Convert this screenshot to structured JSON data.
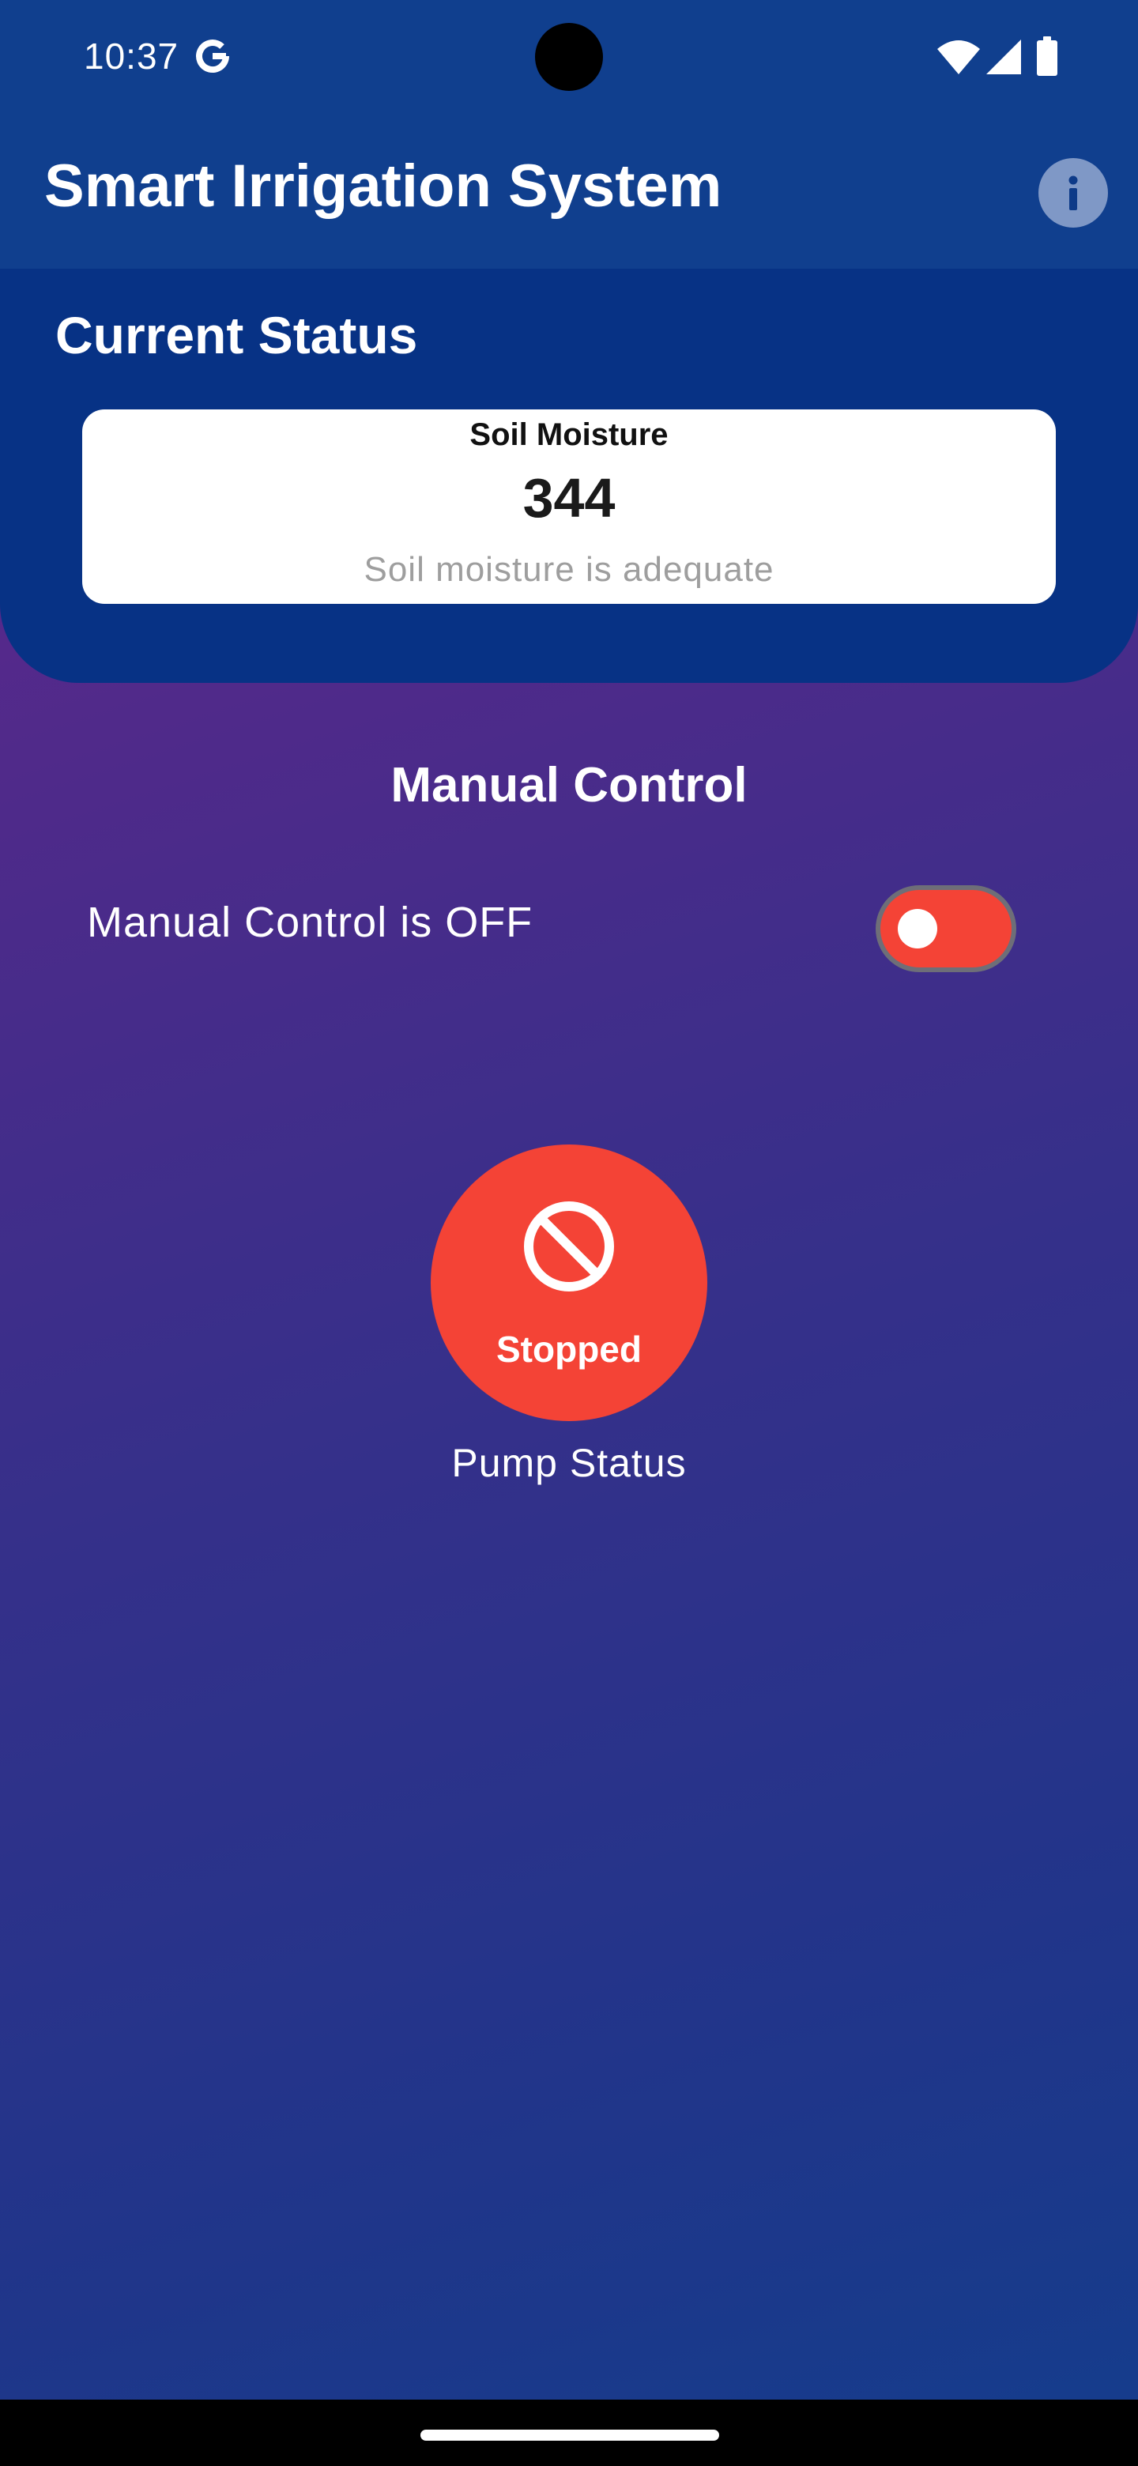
{
  "status_bar": {
    "time": "10:37",
    "icons": [
      "google-g-icon",
      "wifi-icon",
      "cell-signal-icon",
      "battery-icon"
    ]
  },
  "app_bar": {
    "title": "Smart Irrigation System",
    "info_icon": "info-icon"
  },
  "current_status": {
    "title": "Current Status",
    "card": {
      "label": "Soil Moisture",
      "value": "344",
      "message": "Soil moisture is adequate"
    }
  },
  "manual_control": {
    "title": "Manual Control",
    "toggle_label": "Manual Control is OFF",
    "toggle_on": false
  },
  "pump": {
    "state": "Stopped",
    "caption": "Pump Status",
    "icon": "block-icon"
  },
  "colors": {
    "app_bar": "#103f8e",
    "status_panel": "#073285",
    "pump_stopped": "#f44336",
    "toggle_off": "#f44336",
    "gradient_top": "#6a2590",
    "gradient_bottom": "#143d8c"
  }
}
